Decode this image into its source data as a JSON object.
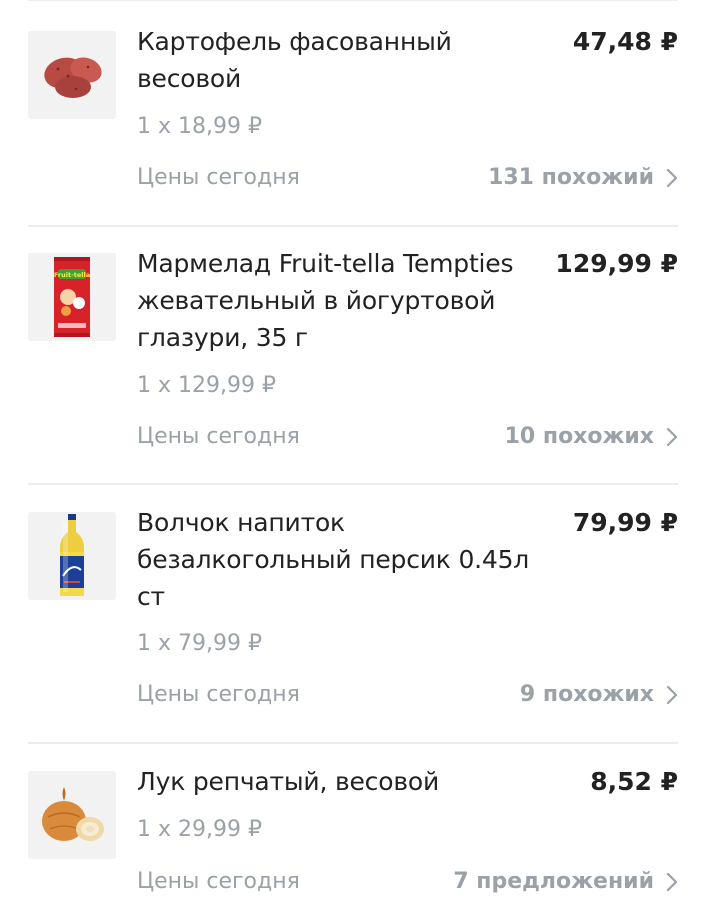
{
  "items": [
    {
      "name": "Картофель фасованный весовой",
      "price": "47,48 ₽",
      "unit": "1 x 18,99 ₽",
      "prices_today": "Цены сегодня",
      "similar": "131 похожий",
      "thumb_icon": "potato-icon"
    },
    {
      "name": "Мармелад Fruit-tella Tempties жевательный в йогуртовой глазури, 35 г",
      "price": "129,99 ₽",
      "unit": "1 x 129,99 ₽",
      "prices_today": "Цены сегодня",
      "similar": "10 похожих",
      "thumb_icon": "candy-pack-icon",
      "thumb_text": "Fruit-tella"
    },
    {
      "name": "Волчок напиток безалкогольный персик 0.45л ст",
      "price": "79,99 ₽",
      "unit": "1 x 79,99 ₽",
      "prices_today": "Цены сегодня",
      "similar": "9 похожих",
      "thumb_icon": "bottle-icon"
    },
    {
      "name": "Лук репчатый, весовой",
      "price": "8,52 ₽",
      "unit": "1 x 29,99 ₽",
      "prices_today": "Цены сегодня",
      "similar": "7 предложений",
      "thumb_icon": "onion-icon"
    }
  ],
  "colors": {
    "text": "#222222",
    "muted": "#9aa1a8",
    "divider": "#ececec"
  }
}
